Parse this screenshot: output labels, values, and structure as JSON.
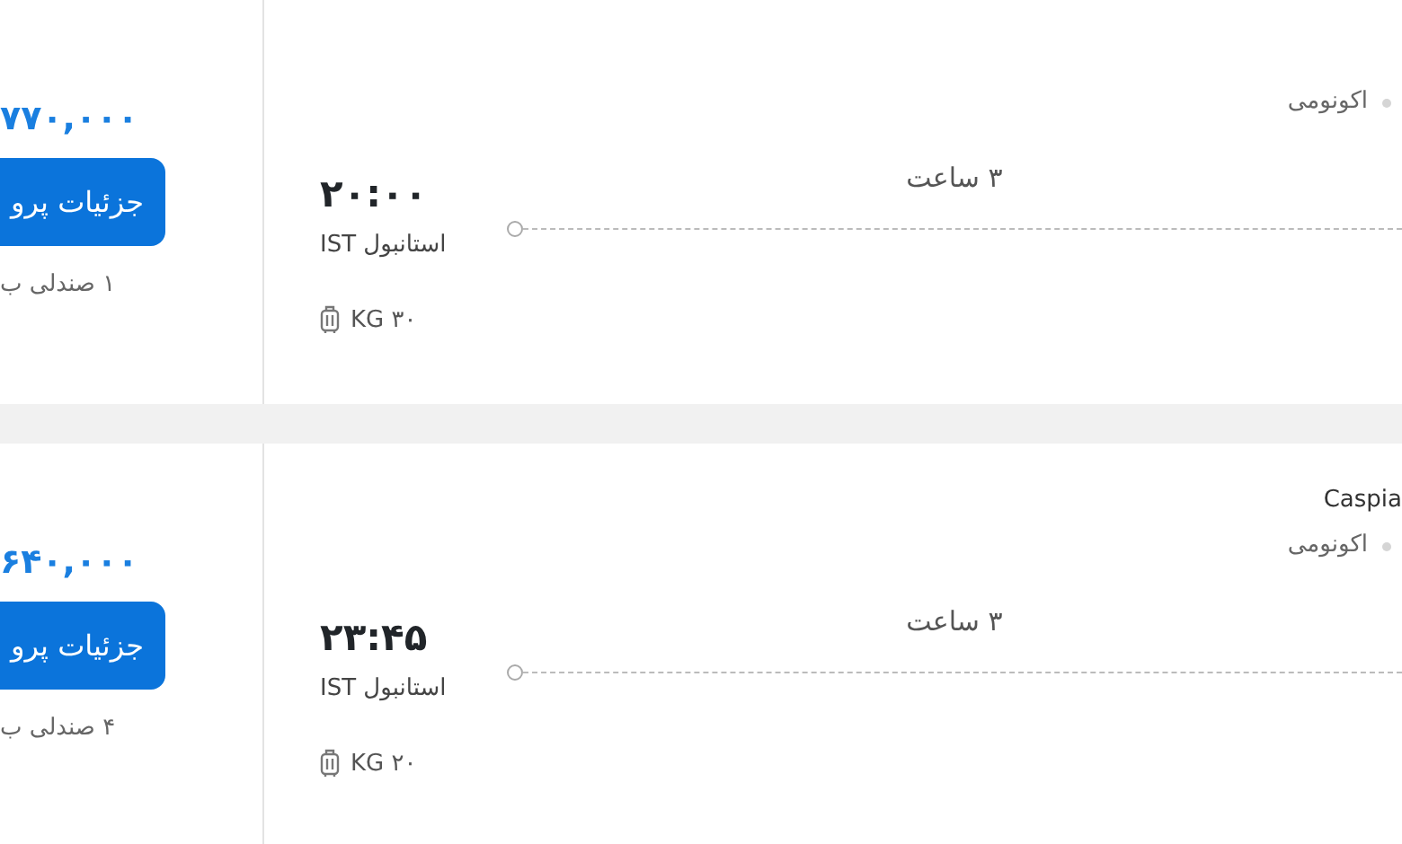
{
  "flights": [
    {
      "price": "۷۷۰,۰۰۰",
      "details_button": "جزئیات پرو",
      "seats": "۱ صندلی ب",
      "cabin_class": "اکونومی",
      "departure_time": "۲۰:۰۰",
      "departure_city": "استانبول IST",
      "duration": "۳ ساعت",
      "baggage": "۳۰ KG"
    },
    {
      "airline": "Caspia",
      "price": "۶۴۰,۰۰۰",
      "details_button": "جزئیات پرو",
      "seats": "۴ صندلی ب",
      "cabin_class": "اکونومی",
      "departure_time": "۲۳:۴۵",
      "departure_city": "استانبول IST",
      "duration": "۳ ساعت",
      "baggage": "۲۰ KG"
    }
  ]
}
